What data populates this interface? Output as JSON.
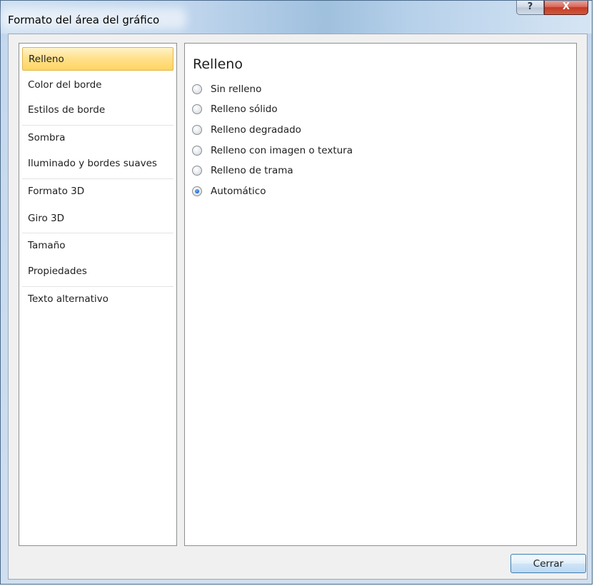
{
  "window": {
    "title": "Formato del área del gráfico",
    "help_label": "?",
    "close_label": "X"
  },
  "nav": {
    "items": [
      {
        "label": "Relleno",
        "selected": true
      },
      {
        "label": "Color del borde",
        "selected": false
      },
      {
        "label": "Estilos de borde",
        "selected": false
      },
      {
        "label": "Sombra",
        "selected": false
      },
      {
        "label": "Iluminado y bordes suaves",
        "selected": false
      },
      {
        "label": "Formato 3D",
        "selected": false
      },
      {
        "label": "Giro 3D",
        "selected": false
      },
      {
        "label": "Tamaño",
        "selected": false
      },
      {
        "label": "Propiedades",
        "selected": false
      },
      {
        "label": "Texto alternativo",
        "selected": false
      }
    ]
  },
  "content": {
    "title": "Relleno",
    "options": [
      {
        "label": "Sin relleno",
        "checked": false
      },
      {
        "label": "Relleno sólido",
        "checked": false
      },
      {
        "label": "Relleno degradado",
        "checked": false
      },
      {
        "label": "Relleno con imagen o textura",
        "checked": false
      },
      {
        "label": "Relleno de trama",
        "checked": false
      },
      {
        "label": "Automático",
        "checked": true
      }
    ]
  },
  "footer": {
    "close_button": "Cerrar"
  },
  "colors": {
    "selected_nav_bg": "#ffd561",
    "close_button_red": "#c43a26",
    "radio_checked": "#1e66c8"
  }
}
